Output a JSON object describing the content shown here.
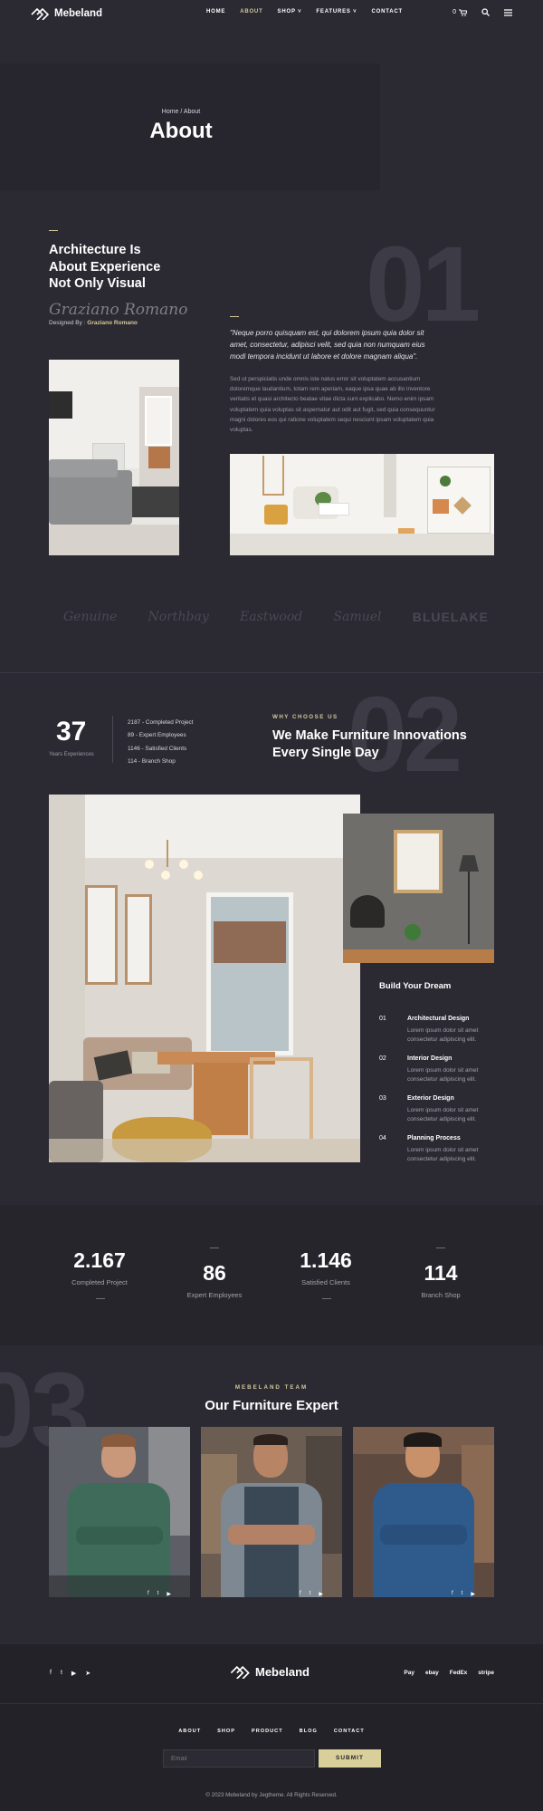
{
  "brand": {
    "name": "Mebeland"
  },
  "nav": {
    "items": [
      "HOME",
      "ABOUT",
      "SHOP ˅",
      "FEATURES ˅",
      "CONTACT"
    ],
    "cart_count": "0"
  },
  "hero": {
    "breadcrumb": "Home / About",
    "title": "About"
  },
  "intro": {
    "number": "01",
    "heading": "Architecture Is About Experience Not Only Visual",
    "signature": "Graziano Romano",
    "designed_by_label": "Designed By :",
    "designer": "Graziano Romano",
    "quote": "\"Neque porro quisquam est, qui dolorem ipsum quia dolor sit amet, consectetur, adipisci velit, sed quia non numquam eius modi tempora incidunt ut labore et dolore magnam aliqua\".",
    "paragraph": "Sed ut perspiciatis unde omnis iste natus error sit voluptatem accusantium doloremque laudantium, totam rem aperiam, eaque ipsa quae ab illo inventore veritatis et quasi architecto beatae vitae dicta sunt explicabo. Nemo enim ipsam voluptatem quia voluptas sit aspernatur aut odit aut fugit, sed quia consequuntur magni dolores eos qui ratione voluptatem sequi nesciunt ipsam voluptatem quia voluptas."
  },
  "brands": [
    "Genuine",
    "Northbay",
    "Eastwood",
    "Samuel",
    "BLUELAKE"
  ],
  "why": {
    "number": "02",
    "experience_value": "37",
    "experience_label": "Years Experiences",
    "stats": [
      "2187 - Completed Project",
      "89 - Expert Employees",
      "1146 - Satisfied Clients",
      "114 - Branch Shop"
    ],
    "eyebrow": "WHY CHOOSE US",
    "heading": "We Make Furniture Innovations Every Single Day"
  },
  "services": {
    "title": "Build Your Dream",
    "items": [
      {
        "num": "01",
        "title": "Architectural Design",
        "desc": "Lorem ipsum dolor sit amet consectetur adipiscing elit."
      },
      {
        "num": "02",
        "title": "Interior Design",
        "desc": "Lorem ipsum dolor sit amet consectetur adipiscing elit."
      },
      {
        "num": "03",
        "title": "Exterior Design",
        "desc": "Lorem ipsum dolor sit amet consectetur adipiscing elit."
      },
      {
        "num": "04",
        "title": "Planning Process",
        "desc": "Lorem ipsum dolor sit amet consectetur adipiscing elit."
      }
    ]
  },
  "counters": [
    {
      "value": "2.167",
      "label": "Completed Project"
    },
    {
      "value": "86",
      "label": "Expert Employees"
    },
    {
      "value": "1.146",
      "label": "Satisfied Clients"
    },
    {
      "value": "114",
      "label": "Branch Shop"
    }
  ],
  "team": {
    "number": "03",
    "eyebrow": "MEBELAND TEAM",
    "title": "Our Furniture Expert"
  },
  "footer": {
    "payments": [
      "Pay",
      "ebay",
      "FedEx",
      "stripe"
    ],
    "links": [
      "ABOUT",
      "SHOP",
      "PRODUCT",
      "BLOG",
      "CONTACT"
    ],
    "email_placeholder": "Email",
    "submit_label": "SUBMIT",
    "copyright": "© 2023 Mebeland by Jegtheme. All Rights Reserved."
  },
  "colors": {
    "background": "#2b2a33",
    "accent": "#d4c89a",
    "panel": "#26252c"
  }
}
